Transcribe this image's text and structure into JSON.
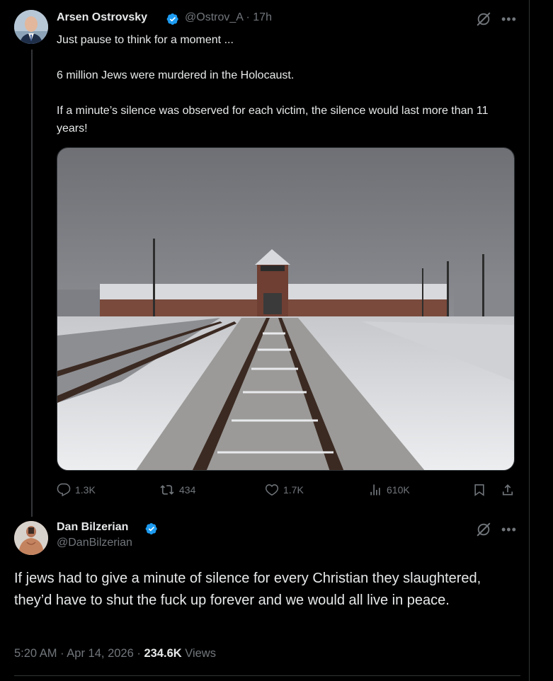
{
  "tweet": {
    "author_name": "Arsen Ostrovsky",
    "handle": "@Ostrov_A",
    "separator": "·",
    "time": "17h",
    "lines": [
      "Just pause to think for a moment ...",
      "6 million Jews were murdered in the Holocaust.",
      "If a minute’s silence was observed for each victim, the silence would last more than 11 years!"
    ],
    "replies": "1.3K",
    "reposts": "434",
    "likes": "1.7K",
    "views": "610K"
  },
  "reply": {
    "author_name": "Dan Bilzerian",
    "handle": "@DanBilzerian",
    "text": "If jews had to give a minute of silence for every Christian they slaughtered, they’d have to shut the fuck up forever and we would all live in peace.",
    "timestamp": "5:20 AM · Apr 14, 2026 · ",
    "views_count": "234.6K",
    "views_label": " Views"
  },
  "icons": {
    "verified": "verified-badge-icon",
    "grok": "grok-icon",
    "more": "more-dots-icon",
    "reply": "reply-icon",
    "repost": "repost-icon",
    "like": "like-icon",
    "views": "views-icon",
    "bookmark": "bookmark-icon",
    "share": "share-icon"
  },
  "colors": {
    "background": "#000000",
    "text": "#e7e9ea",
    "muted": "#71767b",
    "verified": "#1d9bf0"
  }
}
